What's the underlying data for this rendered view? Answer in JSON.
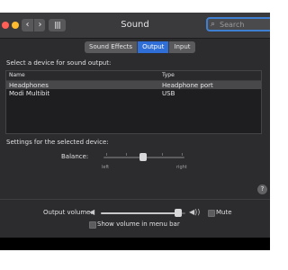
{
  "window": {
    "title": "Sound",
    "search_placeholder": "Search",
    "nav_back": "‹",
    "nav_forward": "›",
    "grid_glyph": "||||"
  },
  "tabs": [
    {
      "label": "Sound Effects",
      "active": false
    },
    {
      "label": "Output",
      "active": true
    },
    {
      "label": "Input",
      "active": false
    }
  ],
  "output": {
    "heading": "Select a device for sound output:",
    "columns": {
      "name": "Name",
      "type": "Type"
    },
    "devices": [
      {
        "name": "Headphones",
        "type": "Headphone port",
        "selected": true
      },
      {
        "name": "Modi Multibit",
        "type": "USB",
        "selected": false
      }
    ]
  },
  "settings": {
    "heading": "Settings for the selected device:",
    "balance_label": "Balance:",
    "balance_left": "left",
    "balance_right": "right",
    "balance_value": 0.5
  },
  "volume": {
    "label": "Output volume:",
    "level": 0.92,
    "mute_label": "Mute",
    "mute_checked": false,
    "menu_bar_label": "Show volume in menu bar",
    "menu_bar_checked": false
  },
  "help": "?",
  "icons": {
    "search": "search-icon",
    "speaker_low": "speaker-low-icon",
    "speaker_high": "speaker-high-icon",
    "help": "help-icon"
  },
  "colors": {
    "accent": "#2f6ed6",
    "focus_ring": "#3f7fd1",
    "close": "#ff5f57",
    "minimize": "#febc2e"
  }
}
